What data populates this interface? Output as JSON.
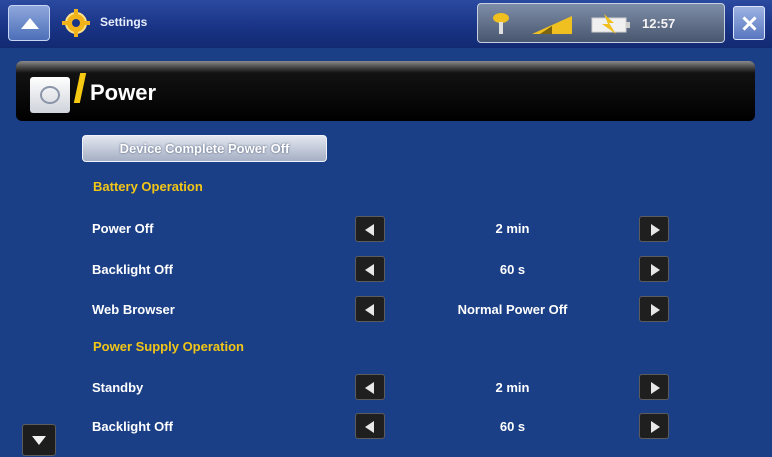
{
  "topbar": {
    "app_title": "Settings",
    "clock": "12:57",
    "icons": [
      "menu-icon",
      "settings-gear-icon",
      "usb-icon",
      "signal-icon",
      "battery-charging-icon",
      "close-icon"
    ]
  },
  "header": {
    "title": "Power",
    "icon": "power-plug-icon"
  },
  "content": {
    "device_power_off_label": "Device Complete Power Off",
    "battery_section": "Battery Operation",
    "supply_section": "Power Supply Operation",
    "battery_rows": [
      {
        "label": "Power Off",
        "value": "2 min"
      },
      {
        "label": "Backlight Off",
        "value": "60 s"
      },
      {
        "label": "Web Browser",
        "value": "Normal Power Off"
      }
    ],
    "supply_rows": [
      {
        "label": "Standby",
        "value": "2 min"
      },
      {
        "label": "Backlight Off",
        "value": "60 s"
      }
    ]
  },
  "colors": {
    "background": "#1b3f86",
    "section_title": "#f2c617",
    "header_bar": "#000000"
  }
}
